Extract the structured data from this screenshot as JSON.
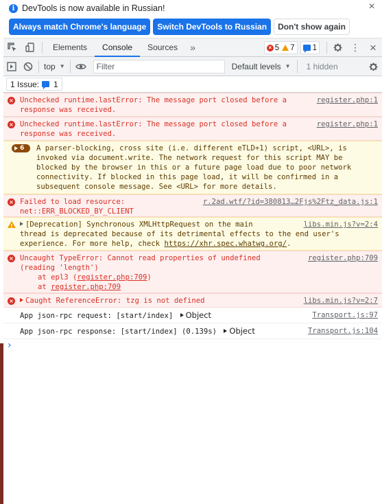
{
  "infobar": {
    "message": "DevTools is now available in Russian!",
    "btn_match": "Always match Chrome's language",
    "btn_switch": "Switch DevTools to Russian",
    "btn_dismiss": "Don't show again"
  },
  "tabbar": {
    "tabs": [
      "Elements",
      "Console",
      "Sources"
    ],
    "active_tab": "Console",
    "error_count": "5",
    "warning_count": "7",
    "message_count": "1"
  },
  "console_toolbar": {
    "context": "top",
    "filter_placeholder": "Filter",
    "levels": "Default levels",
    "hidden": "1 hidden"
  },
  "issues": {
    "label": "1 Issue:",
    "count": "1"
  },
  "messages": [
    {
      "level": "error",
      "text": "Unchecked runtime.lastError: The message port closed before a",
      "text2": "response was received.",
      "source": "register.php:1"
    },
    {
      "level": "error",
      "text": "Unchecked runtime.lastError: The message port closed before a",
      "text2": "response was received.",
      "source": "register.php:1"
    },
    {
      "level": "violation",
      "repeat": "6",
      "lines": [
        "A parser-blocking, cross site (i.e. different eTLD+1) script, <URL>, is",
        "invoked via document.write. The network request for this script MAY be",
        "blocked by the browser in this or a future page load due to poor network",
        "connectivity. If blocked in this page load, it will be confirmed in a",
        "subsequent console message. See <URL> for more details."
      ]
    },
    {
      "level": "error",
      "text": "Failed to load resource:",
      "text2": "net::ERR_BLOCKED_BY_CLIENT",
      "source": "r.2ad.wtf/?id=380813…2Fjs%2Ftz_data.js:1"
    },
    {
      "level": "warning",
      "text": "[Deprecation] Synchronous XMLHttpRequest on the main",
      "text2": "thread is deprecated because of its detrimental effects to the end user's",
      "text3a": "experience. For more help, check ",
      "text3link": "https://xhr.spec.whatwg.org/",
      "text3b": ".",
      "source": "libs.min.js?v=2:4"
    },
    {
      "level": "error",
      "text": "Uncaught TypeError: Cannot read properties of undefined",
      "text2": "(reading 'length')",
      "stack1a": "at epl3 (",
      "stack1link": "register.php:709",
      "stack1b": ")",
      "stack2a": "at ",
      "stack2link": "register.php:709",
      "source": "register.php:709"
    },
    {
      "level": "error",
      "text": "Caught ReferenceError: tzg is not defined",
      "source": "libs.min.js?v=2:7"
    },
    {
      "level": "info",
      "text": "App json-rpc request: [start/index] ",
      "obj": "Object",
      "source": "Transport.js:97"
    },
    {
      "level": "info",
      "text": "App json-rpc response: [start/index] (0.139s) ",
      "obj": "Object",
      "source": "Transport.js:104"
    }
  ],
  "prompt": "›"
}
